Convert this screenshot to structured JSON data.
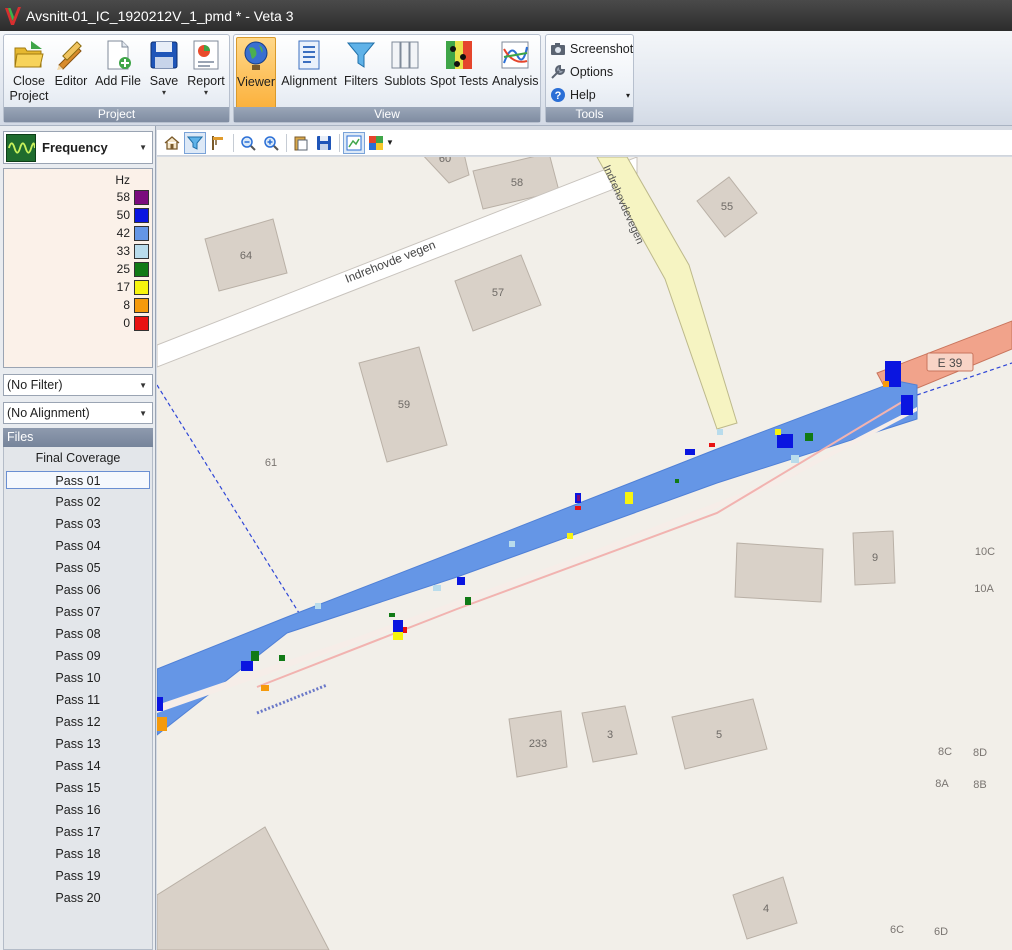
{
  "window": {
    "title": "Avsnitt-01_IC_1920212V_1_pmd * - Veta 3"
  },
  "ribbon": {
    "groups": {
      "project": "Project",
      "view": "View",
      "tools": "Tools"
    },
    "buttons": {
      "close_project_1": "Close",
      "close_project_2": "Project",
      "editor": "Editor",
      "add_file": "Add File",
      "save": "Save",
      "report": "Report",
      "viewer": "Viewer",
      "alignment": "Alignment",
      "filters": "Filters",
      "sublots": "Sublots",
      "spot_tests": "Spot Tests",
      "analysis": "Analysis",
      "screenshot": "Screenshot",
      "options": "Options",
      "help": "Help"
    }
  },
  "left_panel": {
    "measure": "Frequency",
    "legend": {
      "unit": "Hz",
      "entries": [
        {
          "value": "58",
          "color": "#7b0c7e"
        },
        {
          "value": "50",
          "color": "#0a15e0"
        },
        {
          "value": "42",
          "color": "#6596e6"
        },
        {
          "value": "33",
          "color": "#b9dcec"
        },
        {
          "value": "25",
          "color": "#117a16"
        },
        {
          "value": "17",
          "color": "#f7f40e"
        },
        {
          "value": "8",
          "color": "#f59a0c"
        },
        {
          "value": "0",
          "color": "#e81212"
        }
      ]
    },
    "filter": "(No Filter)",
    "alignment": "(No Alignment)",
    "files_header": "Files",
    "files": [
      "Final Coverage",
      "Pass 01",
      "Pass 02",
      "Pass 03",
      "Pass 04",
      "Pass 05",
      "Pass 06",
      "Pass 07",
      "Pass 08",
      "Pass 09",
      "Pass 10",
      "Pass 11",
      "Pass 12",
      "Pass 13",
      "Pass 14",
      "Pass 15",
      "Pass 16",
      "Pass 17",
      "Pass 18",
      "Pass 19",
      "Pass 20"
    ],
    "selected_file": "Pass 01"
  },
  "map": {
    "roads": {
      "indrehovde": "Indrehovde vegen",
      "side_road": "Indrehovdevegen",
      "route": "E 39"
    },
    "buildings": [
      "60",
      "58",
      "55",
      "64",
      "57",
      "59",
      "9",
      "233",
      "3",
      "5",
      "4"
    ],
    "address_labels": [
      "61",
      "10C",
      "10A",
      "8C",
      "8D",
      "8A",
      "8B",
      "6C",
      "6D"
    ],
    "coverage_color": "#6596e6"
  }
}
